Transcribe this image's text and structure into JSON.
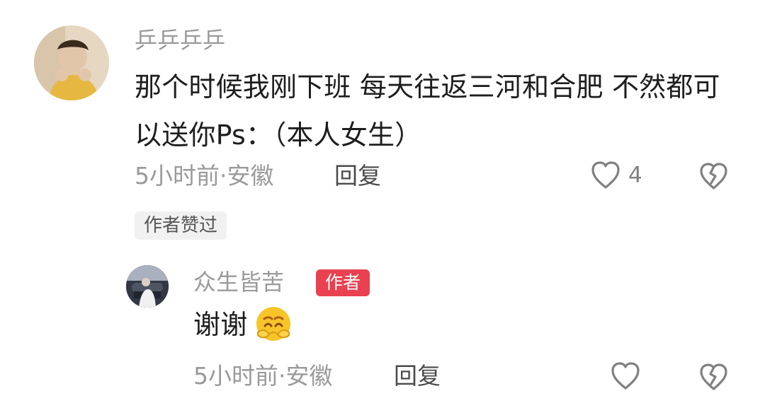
{
  "comments": {
    "main": {
      "username": "乒乒乒乒",
      "text": "那个时候我刚下班 每天往返三河和合肥 不然都可以送你Ps：（本人女生）",
      "meta": "5小时前·安徽",
      "reply_label": "回复",
      "like_count": "4",
      "author_liked_badge": "作者赞过",
      "like_icon": "heart-outline",
      "dislike_icon": "broken-heart-outline"
    },
    "reply": {
      "username": "众生皆苦",
      "author_badge": "作者",
      "text": "谢谢",
      "emoji": "pleading-face-emoji",
      "meta": "5小时前·安徽",
      "reply_label": "回复",
      "like_icon": "heart-outline",
      "dislike_icon": "broken-heart-outline"
    }
  },
  "colors": {
    "text_primary": "#1e1e1e",
    "text_secondary": "#9a9a9a",
    "author_badge_bg": "#e9414f",
    "author_liked_bg": "#f1f1f1",
    "icon_gray": "#808080",
    "emoji_yellow": "#f7c52a"
  }
}
